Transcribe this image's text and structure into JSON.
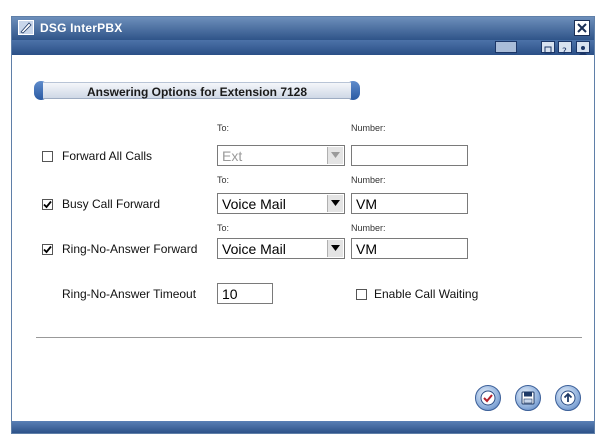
{
  "window": {
    "title": "DSG InterPBX"
  },
  "section": {
    "title": "Answering Options for Extension 7128"
  },
  "labels": {
    "to": "To:",
    "number": "Number:"
  },
  "rows": [
    {
      "label": "Forward All Calls",
      "checked": false,
      "destination": "Ext",
      "number": "",
      "disabled": true
    },
    {
      "label": "Busy Call Forward",
      "checked": true,
      "destination": "Voice Mail",
      "number": "VM",
      "disabled": false
    },
    {
      "label": "Ring-No-Answer Forward",
      "checked": true,
      "destination": "Voice Mail",
      "number": "VM",
      "disabled": false
    }
  ],
  "timeout": {
    "label": "Ring-No-Answer Timeout",
    "value": "10"
  },
  "call_waiting": {
    "label": "Enable Call Waiting",
    "checked": false
  },
  "icons": {
    "ok": "check-circle-icon",
    "save": "save-disk-icon",
    "up": "up-arrow-icon"
  },
  "colors": {
    "titlebar": "#2f5489",
    "accent": "#4d77b8"
  }
}
